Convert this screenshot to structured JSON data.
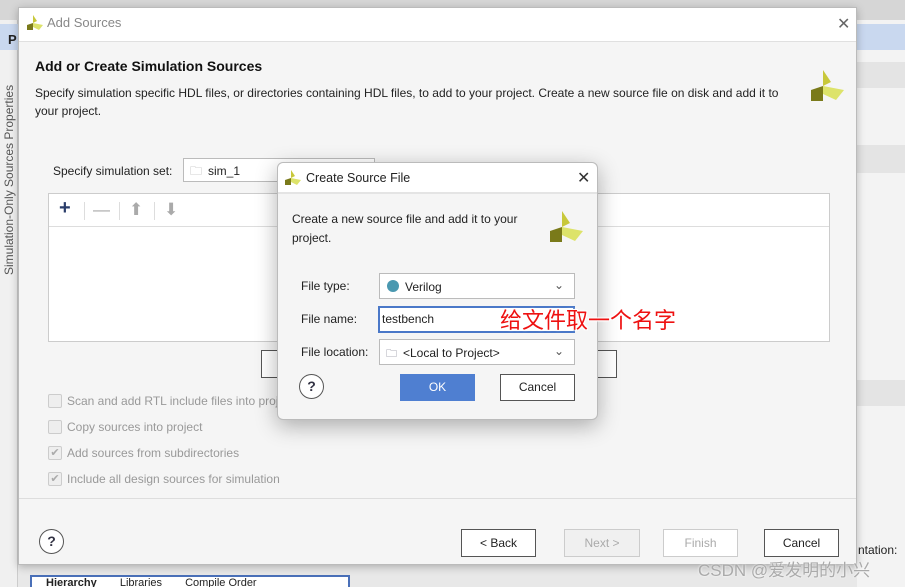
{
  "background": {
    "side_panel_tab": "P",
    "side_panel_label": "Simulation-Only Sources Properties",
    "right_panel_text": "ntation:",
    "bottom_tabs": [
      "Hierarchy",
      "Libraries",
      "Compile Order"
    ]
  },
  "add_sources": {
    "title": "Add Sources",
    "heading": "Add or Create Simulation Sources",
    "description": "Specify simulation specific HDL files, or directories containing HDL files, to add to your project. Create a new source file on disk and add it to your project.",
    "sim_set_label": "Specify simulation set:",
    "sim_set_value": "sim_1",
    "toolbar_icons": [
      "plus-icon",
      "minus-icon",
      "arrow-up-icon",
      "arrow-down-icon"
    ],
    "options": [
      {
        "label": "Scan and add RTL include files into project",
        "checked": false
      },
      {
        "label": "Copy sources into project",
        "checked": false
      },
      {
        "label": "Add sources from subdirectories",
        "checked": true
      },
      {
        "label": "Include all design sources for simulation",
        "checked": true
      }
    ],
    "buttons": {
      "help": "?",
      "back": "< Back",
      "next": "Next >",
      "finish": "Finish",
      "cancel": "Cancel"
    }
  },
  "create_source_file": {
    "title": "Create Source File",
    "description": "Create a new source file and add it to your project.",
    "file_type_label": "File type:",
    "file_type_value": "Verilog",
    "file_name_label": "File name:",
    "file_name_value": "testbench",
    "file_location_label": "File location:",
    "file_location_value": "<Local to Project>",
    "buttons": {
      "help": "?",
      "ok": "OK",
      "cancel": "Cancel"
    }
  },
  "annotation": "给文件取一个名字",
  "watermark": "CSDN @爱发明的小兴",
  "colors": {
    "accent": "#4f7fd1",
    "annotation": "#ee1111",
    "verilog_dot": "#4a98b0"
  }
}
